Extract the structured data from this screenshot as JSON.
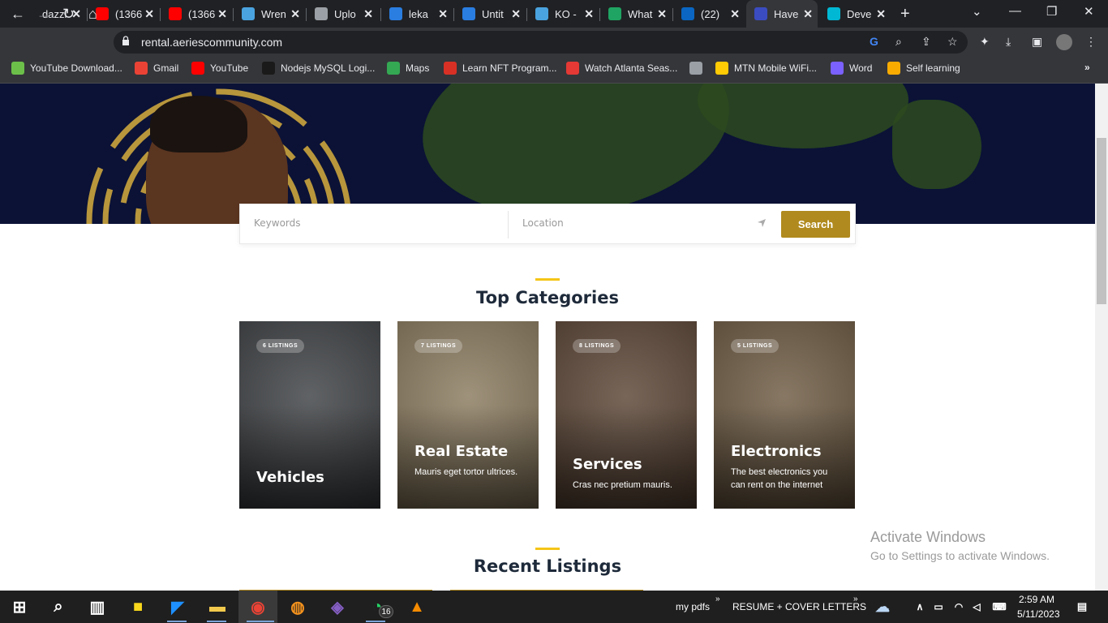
{
  "browser": {
    "tabs": [
      {
        "title": "dazzl",
        "favicon": "dark",
        "color": "#202124"
      },
      {
        "title": "(1366",
        "favicon": "youtube-icon",
        "color": "#ff0000"
      },
      {
        "title": "(1366",
        "favicon": "youtube-icon",
        "color": "#ff0000"
      },
      {
        "title": "Wren",
        "favicon": "wren-icon",
        "color": "#4aa3df"
      },
      {
        "title": "Uplo",
        "favicon": "stack-icon",
        "color": "#9aa0a6"
      },
      {
        "title": "leka",
        "favicon": "canva-icon",
        "color": "#2a7de1"
      },
      {
        "title": "Untit",
        "favicon": "canva-icon",
        "color": "#2a7de1"
      },
      {
        "title": "KO -",
        "favicon": "wren-icon",
        "color": "#4aa3df"
      },
      {
        "title": "What",
        "favicon": "sheet-icon",
        "color": "#1fa463"
      },
      {
        "title": "(22)",
        "favicon": "linkedin-icon",
        "color": "#0a66c2"
      },
      {
        "title": "Have",
        "favicon": "h-icon",
        "color": "#3b4cc0"
      },
      {
        "title": "Deve",
        "favicon": "dev-icon",
        "color": "#00b8d4"
      }
    ],
    "active_tab": 10,
    "url": "rental.aeriescommunity.com",
    "bookmarks": [
      {
        "label": "YouTube Download...",
        "icon": "download-icon",
        "color": "#6cc04a"
      },
      {
        "label": "Gmail",
        "icon": "gmail-icon",
        "color": "#ea4335"
      },
      {
        "label": "YouTube",
        "icon": "youtube-icon",
        "color": "#ff0000"
      },
      {
        "label": "Nodejs MySQL Logi...",
        "icon": "sk-icon",
        "color": "#1a1a1a"
      },
      {
        "label": "Maps",
        "icon": "maps-icon",
        "color": "#34a853"
      },
      {
        "label": "Learn NFT Program...",
        "icon": "c-icon",
        "color": "#d93025"
      },
      {
        "label": "Watch Atlanta Seas...",
        "icon": "play-icon",
        "color": "#e53935"
      },
      {
        "label": "",
        "icon": "globe-icon",
        "color": "#9aa0a6"
      },
      {
        "label": "MTN Mobile WiFi...",
        "icon": "mtn-icon",
        "color": "#ffcb05"
      },
      {
        "label": "Word",
        "icon": "word-icon",
        "color": "#7b61ff"
      },
      {
        "label": "Self learning",
        "icon": "bars-icon",
        "color": "#f9ab00"
      }
    ]
  },
  "search": {
    "keywords_placeholder": "Keywords",
    "location_placeholder": "Location",
    "button": "Search"
  },
  "top_categories": {
    "title": "Top Categories",
    "cards": [
      {
        "badge": "6 LISTINGS",
        "title": "Vehicles",
        "desc": "",
        "bg": "#3d4043"
      },
      {
        "badge": "7 LISTINGS",
        "title": "Real Estate",
        "desc": "Mauris eget tortor ultrices.",
        "bg": "#8a7a5e"
      },
      {
        "badge": "8 LISTINGS",
        "title": "Services",
        "desc": "Cras nec pretium mauris.",
        "bg": "#5a4434"
      },
      {
        "badge": "5 LISTINGS",
        "title": "Electronics",
        "desc": "The best electronics you can rent on the internet",
        "bg": "#6d5a42"
      }
    ]
  },
  "recent_listings": {
    "title": "Recent Listings"
  },
  "watermark": {
    "line1": "Activate Windows",
    "line2": "Go to Settings to activate Windows."
  },
  "taskbar": {
    "items": [
      "windows-icon",
      "search-icon",
      "task-view-icon",
      "sticky-notes-icon",
      "vscode-icon",
      "file-explorer-icon",
      "chrome-icon",
      "fl-studio-icon",
      "visual-studio-icon",
      "whatsapp-icon",
      "vlc-icon"
    ],
    "whatsapp_badge": "16",
    "toolbar1": "my pdfs",
    "toolbar2": "RESUME + COVER LETTERS",
    "time": "2:59 AM",
    "date": "5/11/2023"
  }
}
